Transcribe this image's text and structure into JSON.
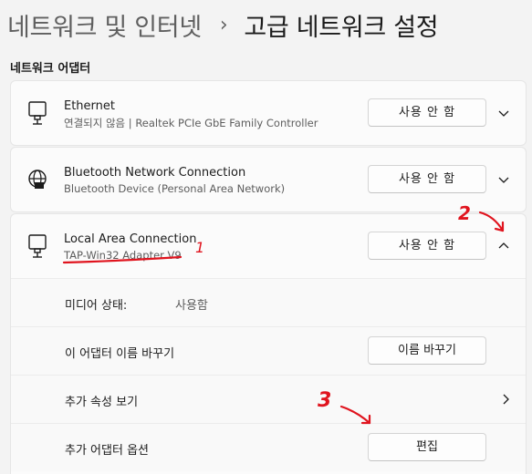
{
  "breadcrumb": {
    "parent": "네트워크 및 인터넷",
    "separator": "›",
    "current": "고급 네트워크 설정"
  },
  "section_title": "네트워크 어댑터",
  "adapters": [
    {
      "name": "Ethernet",
      "description": "연결되지 않음 | Realtek PCIe GbE Family Controller",
      "icon": "ethernet-adapter-icon",
      "button_label": "사용 안 함",
      "expanded": false
    },
    {
      "name": "Bluetooth Network Connection",
      "description": "Bluetooth Device (Personal Area Network)",
      "icon": "bluetooth-network-globe-icon",
      "button_label": "사용 안 함",
      "expanded": false
    },
    {
      "name": "Local Area Connection",
      "description": "TAP-Win32 Adapter V9",
      "icon": "ethernet-adapter-icon",
      "button_label": "사용 안 함",
      "expanded": true
    }
  ],
  "details": {
    "media_state_label": "미디어 상태:",
    "media_state_value": "사용함",
    "rename_label": "이 어댑터 이름 바꾸기",
    "rename_button": "이름 바꾸기",
    "more_properties_label": "추가 속성 보기",
    "more_options_label": "추가 어댑터 옵션",
    "edit_button": "편집"
  },
  "annotations": {
    "color": "#e0141e",
    "marks": [
      "1",
      "2",
      "3"
    ]
  }
}
